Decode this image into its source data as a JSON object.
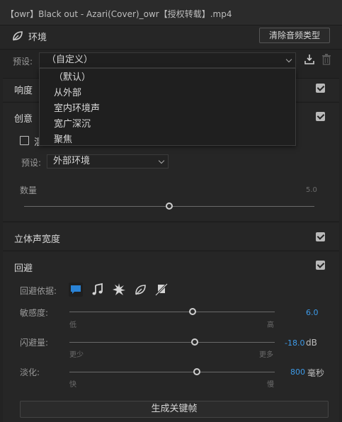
{
  "window": {
    "title": "【owr】Black out - Azari(Cover)_owr【授权转载】.mp4"
  },
  "header": {
    "label": "环境",
    "clear_button": "清除音频类型"
  },
  "preset": {
    "label": "预设:",
    "selected": "（自定义）"
  },
  "dropdown": {
    "options": [
      "（默认）",
      "从外部",
      "室内环境声",
      "宽广深沉",
      "聚焦"
    ]
  },
  "sections": {
    "loudness": {
      "label": "响度",
      "checked": true
    },
    "creative": {
      "label": "创意",
      "checked": true,
      "sub_checkbox_label": "混",
      "sub_checkbox_checked": false,
      "preset_label": "预设:",
      "preset_value": "外部环境",
      "amount_label": "数量",
      "amount_value": "5.0",
      "amount_fraction": 0.5
    },
    "stereo": {
      "label": "立体声宽度",
      "checked": true
    },
    "ducking": {
      "label": "回避",
      "checked": true,
      "target_label": "回避依据:",
      "sensitivity": {
        "label": "敏感度:",
        "value": "6.0",
        "unit": "",
        "min_label": "低",
        "max_label": "高",
        "fraction": 0.6
      },
      "amount": {
        "label": "闪避量:",
        "value": "-18.0",
        "unit": "dB",
        "min_label": "更少",
        "max_label": "更多",
        "fraction": 0.61
      },
      "fade": {
        "label": "淡化:",
        "value": "800",
        "unit": "毫秒",
        "min_label": "快",
        "max_label": "慢",
        "fraction": 0.62
      }
    }
  },
  "generate_button": "生成关键帧",
  "colors": {
    "accent": "#3d9be9",
    "active_icon": "#2a83d6"
  },
  "icons": [
    "leaf-icon",
    "save-preset-icon",
    "trash-icon",
    "dialogue-icon",
    "music-icon",
    "sfx-icon",
    "ambience-icon",
    "no-type-icon"
  ]
}
